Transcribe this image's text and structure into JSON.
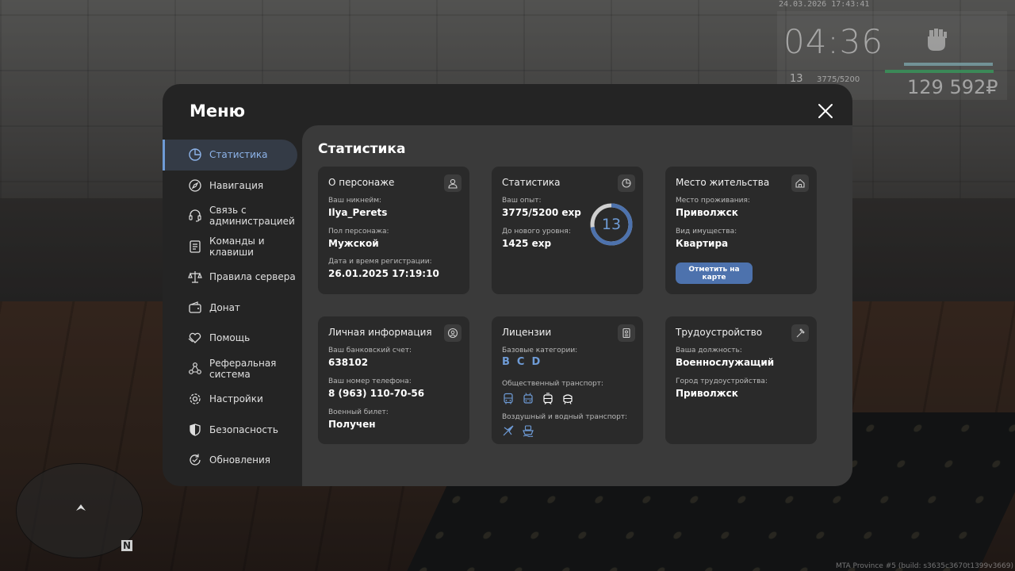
{
  "hud": {
    "date": "24.03.2026 17:43:41",
    "time": "04:36",
    "level": "13",
    "exp": "3775/5200",
    "money": "129 592₽"
  },
  "footer": {
    "build": "MTA Province #5 (build: s3635c3670t1399v3669)"
  },
  "menu": {
    "title": "Меню",
    "sidebar": [
      {
        "label": "Статистика",
        "icon": "pie-chart-icon",
        "active": true
      },
      {
        "label": "Навигация",
        "icon": "compass-icon"
      },
      {
        "label": "Связь с администрацией",
        "icon": "headset-icon"
      },
      {
        "label": "Команды и клавиши",
        "icon": "keyboard-icon"
      },
      {
        "label": "Правила сервера",
        "icon": "scales-icon"
      },
      {
        "label": "Донат",
        "icon": "wallet-icon"
      },
      {
        "label": "Помощь",
        "icon": "heart-hands-icon"
      },
      {
        "label": "Реферальная система",
        "icon": "share-icon"
      },
      {
        "label": "Настройки",
        "icon": "gear-icon"
      },
      {
        "label": "Безопасность",
        "icon": "shield-icon"
      },
      {
        "label": "Обновления",
        "icon": "refresh-icon"
      }
    ],
    "page_title": "Статистика",
    "cards": {
      "character": {
        "title": "О персонаже",
        "nickname_label": "Ваш никнейм:",
        "nickname": "Ilya_Perets",
        "gender_label": "Пол персонажа:",
        "gender": "Мужской",
        "reg_label": "Дата и время регистрации:",
        "reg": "26.01.2025 17:19:10"
      },
      "stats": {
        "title": "Статистика",
        "exp_label": "Ваш опыт:",
        "exp": "3775/5200 exp",
        "next_label": "До нового уровня:",
        "next": "1425 exp",
        "level": "13",
        "progress": 0.726
      },
      "residence": {
        "title": "Место жительства",
        "place_label": "Место проживания:",
        "place": "Приволжск",
        "property_label": "Вид имущества:",
        "property": "Квартира",
        "button": "Отметить на карте"
      },
      "personal": {
        "title": "Личная информация",
        "bank_label": "Ваш банковский счет:",
        "bank": "638102",
        "phone_label": "Ваш номер телефона:",
        "phone": "8 (963) 110-70-56",
        "military_label": "Военный билет:",
        "military": "Получен"
      },
      "licenses": {
        "title": "Лицензии",
        "base_label": "Базовые категории:",
        "categories": [
          "B",
          "C",
          "D"
        ],
        "public_label": "Общественный транспорт:",
        "public_icons": [
          "bus-icon",
          "trolleybus-icon",
          "tram-icon",
          "metro-icon"
        ],
        "air_label": "Воздушный и водный транспорт:",
        "air_icons": [
          "plane-icon",
          "boat-icon"
        ]
      },
      "employment": {
        "title": "Трудоустройство",
        "position_label": "Ваша должность:",
        "position": "Военнослужащий",
        "city_label": "Город трудоустройства:",
        "city": "Приволжск"
      }
    }
  },
  "colors": {
    "accent": "#6e9bd6",
    "button": "#4d72ad",
    "panel": "#242424",
    "content": "#3a3a3a",
    "card": "#2a2a2a"
  }
}
